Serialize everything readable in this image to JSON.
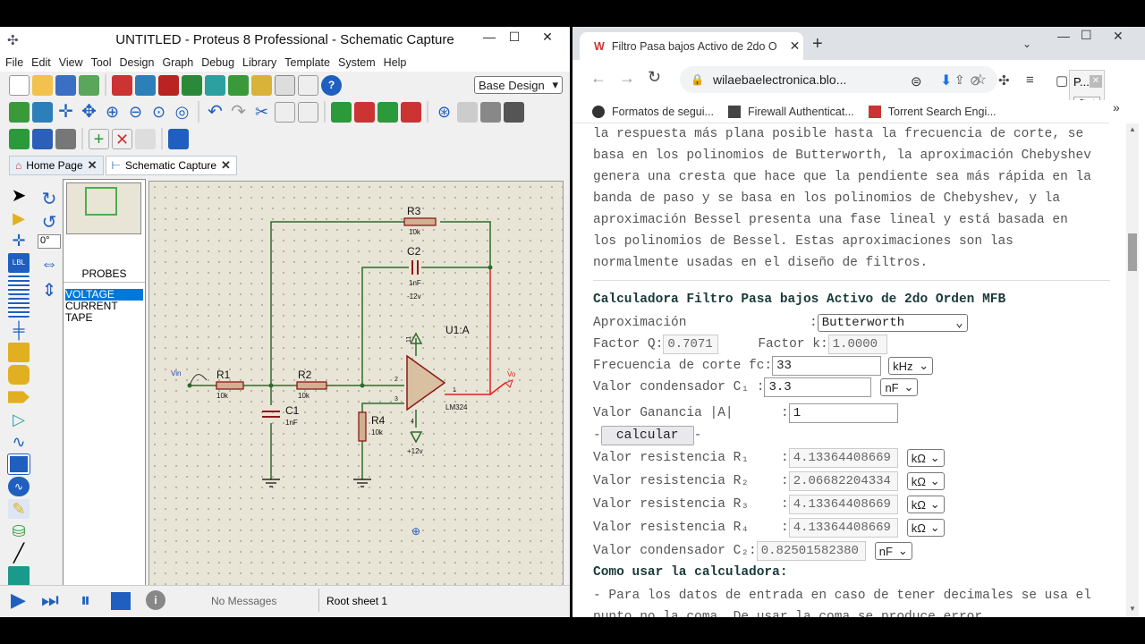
{
  "proteus": {
    "title": "UNTITLED - Proteus 8 Professional - Schematic Capture",
    "menu": [
      "File",
      "Edit",
      "View",
      "Tool",
      "Design",
      "Graph",
      "Debug",
      "Library",
      "Template",
      "System",
      "Help"
    ],
    "design_select": "Base Design",
    "tabs": [
      {
        "label": "Home Page"
      },
      {
        "label": "Schematic Capture"
      }
    ],
    "rotation_value": "0°",
    "panel_header": "PROBES",
    "probes": [
      "VOLTAGE",
      "CURRENT",
      "TAPE"
    ],
    "status": {
      "messages": "No Messages",
      "sheet": "Root sheet 1"
    },
    "schematic": {
      "R1": "R1",
      "R1_val": "10k",
      "R2": "R2",
      "R2_val": "10k",
      "R3": "R3",
      "R3_val": "10k",
      "R4": "R4",
      "R4_val": "10k",
      "C1": "C1",
      "C1_val": "1nF",
      "C2": "C2",
      "C2_val": "1nF",
      "U1": "U1:A",
      "U1_part": "LM324",
      "vneg": "-12v",
      "vpos": "+12v",
      "vin": "Vin",
      "vo": "Vo",
      "pin11": "11",
      "pin4": "4",
      "pin2": "2",
      "pin3": "3",
      "pin1": "1"
    }
  },
  "browser": {
    "tab_title": "Filtro Pasa bajos Activo de 2do O",
    "url": "wilaebaelectronica.blo...",
    "profile_label": "P...",
    "start_label": "Start",
    "bookmarks": [
      "Formatos de segui...",
      "Firewall Authenticat...",
      "Torrent Search Engi..."
    ],
    "intro_lines": [
      "la respuesta más plana posible hasta la frecuencia de corte, se",
      "basa en los polinomios de Butterworth, la aproximación Chebyshev",
      "genera una cresta que hace que la pendiente sea más rápida en la",
      "banda de paso y se basa en los polinomios de Chebyshev, y la",
      "aproximación Bessel presenta una fase lineal y está basada en",
      "los polinomios de Bessel. Estas aproximaciones son las",
      "normalmente usadas en el diseño de filtros."
    ],
    "calc": {
      "heading": "Calculadora Filtro Pasa bajos Activo de 2do Orden MFB",
      "aprox_label": "Aproximación",
      "aprox_value": "Butterworth",
      "q_label": "Factor Q:",
      "q_value": "0.7071",
      "k_label": "Factor k:",
      "k_value": "1.0000",
      "fc_label": "Frecuencia de corte fc:",
      "fc_value": "33",
      "fc_unit": "kHz",
      "c1_label": "Valor condensador C₁ :",
      "c1_value": "3.3",
      "c1_unit": "nF",
      "gain_label": "Valor Ganancia |A|",
      "gain_value": "1",
      "calc_button": "calcular",
      "results": [
        {
          "label": "Valor resistencia R₁",
          "value": "4.13364408669",
          "unit": "kΩ"
        },
        {
          "label": "Valor resistencia R₂",
          "value": "2.06682204334",
          "unit": "kΩ"
        },
        {
          "label": "Valor resistencia R₃",
          "value": "4.13364408669",
          "unit": "kΩ"
        },
        {
          "label": "Valor resistencia R₄",
          "value": "4.13364408669",
          "unit": "kΩ"
        }
      ],
      "c2_label": "Valor condensador C₂:",
      "c2_value": "0.82501582380",
      "c2_unit": "nF",
      "howto_heading": "Como usar la calculadora:",
      "howto_lines": [
        "- Para los datos de entrada en caso de tener decimales se usa el",
        "punto no la coma. De usar la coma se produce error."
      ]
    }
  },
  "colors": {
    "accent": "#0078d7",
    "wire": "#2d6b2d",
    "wire_hot": "#e02020",
    "component": "#8b1a1a"
  }
}
